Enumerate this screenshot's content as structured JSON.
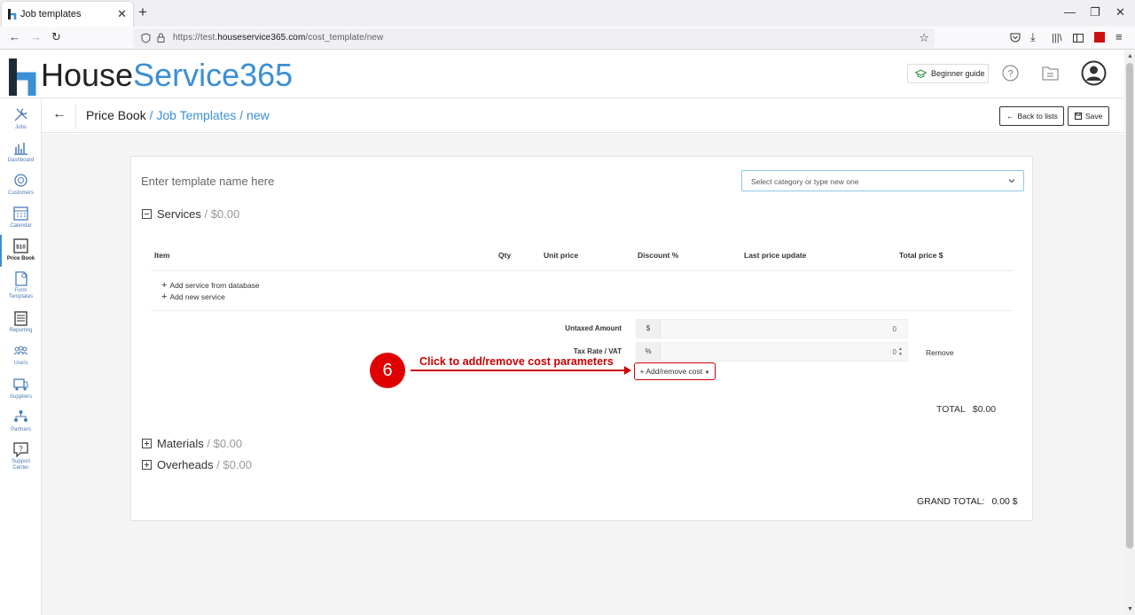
{
  "browser": {
    "tab_title": "Job templates",
    "url_prefix": "https://test.",
    "url_domain": "houseservice365.com",
    "url_path": "/cost_template/new"
  },
  "header": {
    "logo_house": "House",
    "logo_service": "Service365",
    "beginner_guide": "Beginner guide"
  },
  "sidebar": {
    "items": [
      {
        "label": "Jobs",
        "icon": "tools-icon"
      },
      {
        "label": "Dashboard",
        "icon": "bar-chart-icon"
      },
      {
        "label": "Customers",
        "icon": "customers-icon"
      },
      {
        "label": "Calendar",
        "icon": "calendar-icon"
      },
      {
        "label": "Price Book",
        "icon": "price-tag-icon",
        "active": true
      },
      {
        "label": "Form",
        "label2": "Templates",
        "icon": "form-icon"
      },
      {
        "label": "Reporting",
        "icon": "report-icon"
      },
      {
        "label": "Users",
        "icon": "users-icon"
      },
      {
        "label": "Suppliers",
        "icon": "truck-icon"
      },
      {
        "label": "Partners",
        "icon": "partners-icon"
      },
      {
        "label": "Support",
        "label2": "Center",
        "icon": "support-icon"
      }
    ]
  },
  "breadcrumb": {
    "root": "Price Book",
    "rest": " / Job Templates / new",
    "back_to_lists": "Back to lists",
    "save": "Save"
  },
  "form": {
    "name_placeholder": "Enter template name here",
    "category_placeholder": "Select category or type new one",
    "services": {
      "title": "Services",
      "amount": " / $0.00"
    },
    "materials": {
      "title": "Materials",
      "amount": " / $0.00"
    },
    "overheads": {
      "title": "Overheads",
      "amount": " / $0.00"
    },
    "columns": [
      "Item",
      "Qty",
      "Unit price",
      "Discount %",
      "Last price update",
      "Total price $"
    ],
    "add_service_db": "Add service from database",
    "add_new_service": "Add new service",
    "untaxed_label": "Untaxed Amount",
    "untaxed_prefix": "$",
    "untaxed_value": "0",
    "tax_label": "Tax Rate / VAT",
    "tax_prefix": "%",
    "tax_value": "0",
    "remove": "Remove",
    "add_remove_cost": "+ Add/remove cost",
    "total_label": "TOTAL",
    "total_value": "$0.00",
    "grand_total_label": "GRAND TOTAL:",
    "grand_total_value": "0.00 $"
  },
  "annotation": {
    "step": "6",
    "text": "Click to add/remove cost parameters"
  },
  "colors": {
    "brand_blue": "#3b8fd4",
    "annotation_red": "#cc0000"
  }
}
